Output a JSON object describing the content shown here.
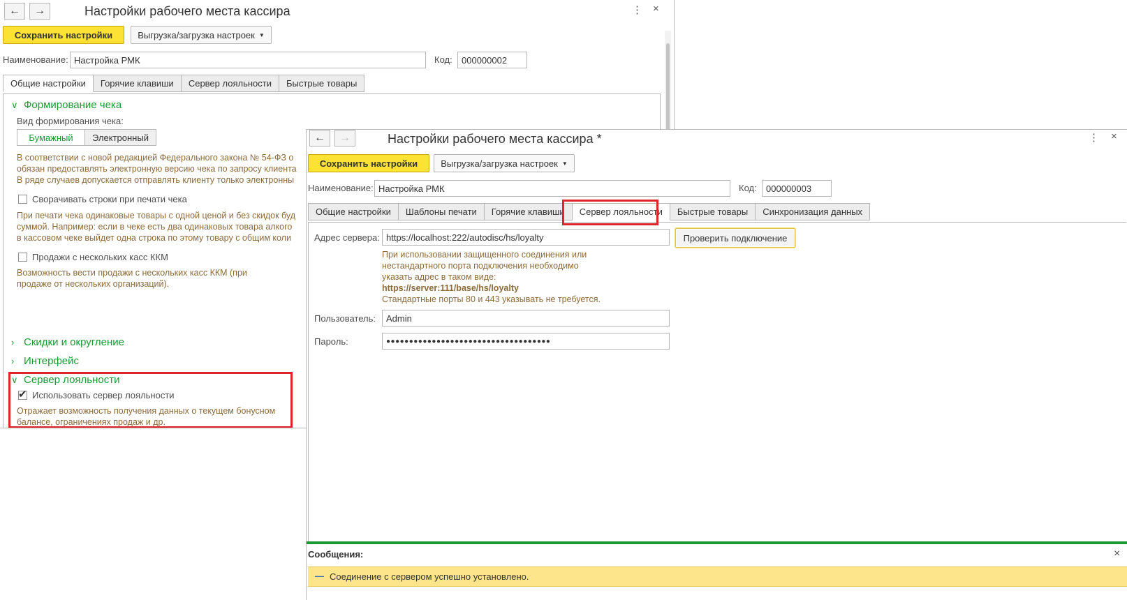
{
  "back_window": {
    "title": "Настройки рабочего места кассира",
    "save_label": "Сохранить настройки",
    "export_label": "Выгрузка/загрузка настроек",
    "name_label": "Наименование:",
    "name_value": "Настройка РМК",
    "code_label": "Код:",
    "code_value": "000000002",
    "tabs": [
      "Общие настройки",
      "Горячие клавиши",
      "Сервер лояльности",
      "Быстрые товары"
    ],
    "section_receipt": "Формирование чека",
    "receipt_kind_label": "Вид формирования чека:",
    "receipt_kind_options": [
      "Бумажный",
      "Электронный"
    ],
    "law_hint": [
      "В соответствии с новой редакцией Федерального закона № 54-ФЗ о",
      "обязан предоставлять электронную версию чека по запросу клиента",
      "В ряде случаев допускается отправлять клиенту только электронны"
    ],
    "collapse_rows_label": "Сворачивать строки при печати чека",
    "collapse_hint": [
      "При печати чека одинаковые товары с одной ценой и без скидок буд",
      "суммой. Например: если в чеке есть два одинаковых товара алкого",
      "в кассовом чеке выйдет одна строка по этому товару с общим коли"
    ],
    "multi_kkm_label": "Продажи с нескольких касс ККМ",
    "multi_kkm_hint": [
      "Возможность вести продажи с нескольких касс ККМ (при",
      "продаже от нескольких организаций)."
    ],
    "section_discounts": "Скидки и округление",
    "section_interface": "Интерфейс",
    "section_loyalty": "Сервер лояльности",
    "use_loyalty_label": "Использовать сервер лояльности",
    "use_loyalty_checked": true,
    "loyalty_hint": [
      "Отражает возможность получения данных о текущем бонусном",
      "балансе, ограничениях продаж и др."
    ]
  },
  "front_window": {
    "title": "Настройки рабочего места кассира *",
    "save_label": "Сохранить настройки",
    "export_label": "Выгрузка/загрузка настроек",
    "name_label": "Наименование:",
    "name_value": "Настройка РМК",
    "code_label": "Код:",
    "code_value": "000000003",
    "tabs": [
      "Общие настройки",
      "Шаблоны печати",
      "Горячие клавиши",
      "Сервер лояльности",
      "Быстрые товары",
      "Синхронизация данных"
    ],
    "active_tab": "Сервер лояльности",
    "server_address_label": "Адрес сервера:",
    "server_address_value": "https://localhost:222/autodisc/hs/loyalty",
    "check_connection_label": "Проверить подключение",
    "address_hint": [
      "При использовании защищенного соединения или",
      "нестандартного порта подключения необходимо",
      "указать адрес в таком виде:"
    ],
    "address_example": "https://server:111/base/hs/loyalty",
    "ports_hint": "Стандартные порты 80 и 443 указывать не требуется.",
    "user_label": "Пользователь:",
    "user_value": "Admin",
    "password_label": "Пароль:",
    "password_value": "●●●●●●●●●●●●●●●●●●●●●●●●●●●●●●●●●●●●",
    "messages_label": "Сообщения:",
    "message_text": "Соединение с сервером успешно установлено.",
    "message_marker": "—"
  },
  "icons": {
    "back": "←",
    "forward": "→",
    "more": "⋮",
    "close": "×",
    "chevron_down": "∨",
    "chevron_right": "›"
  },
  "colors": {
    "accent_green": "#1a9a32",
    "save_yellow": "#fbe234",
    "highlight_red": "#e0242a",
    "message_yellow": "#fde58c"
  }
}
